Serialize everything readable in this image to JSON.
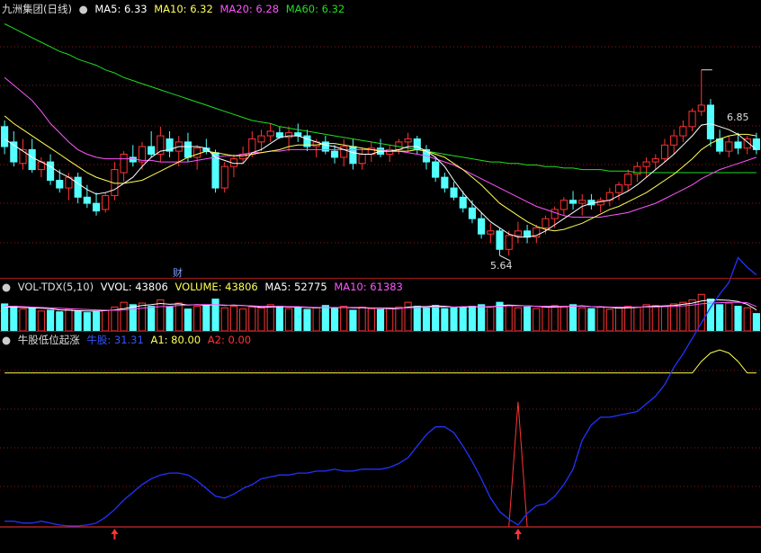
{
  "panel_price": {
    "title": "九洲集团(日线)",
    "indicators": [
      {
        "label": "MA5: 6.33",
        "color": "#ffffff"
      },
      {
        "label": "MA10: 6.32",
        "color": "#ffff55"
      },
      {
        "label": "MA20: 6.28",
        "color": "#ff55ff"
      },
      {
        "label": "MA60: 6.32",
        "color": "#22dd22"
      }
    ],
    "high_label": "6.85",
    "low_label": "5.64",
    "marker_label": "财"
  },
  "panel_volume": {
    "indicators": [
      {
        "label": "VOL-TDX(5,10)",
        "color": "#dddddd"
      },
      {
        "label": "VVOL: 43806",
        "color": "#ffffff"
      },
      {
        "label": "VOLUME: 43806",
        "color": "#ffff55"
      },
      {
        "label": "MA5: 52775",
        "color": "#ffffff"
      },
      {
        "label": "MA10: 61383",
        "color": "#ff55ff"
      }
    ]
  },
  "panel_indicator": {
    "indicators": [
      {
        "label": "牛股低位起涨",
        "color": "#dddddd"
      },
      {
        "label": "牛股: 31.31",
        "color": "#3355ff"
      },
      {
        "label": "A1: 80.00",
        "color": "#ffff55"
      },
      {
        "label": "A2: 0.00",
        "color": "#ff3333"
      }
    ]
  },
  "colors": {
    "up": "#ff3333",
    "down": "#54ffff",
    "ma5": "#ffffff",
    "ma10": "#ffff55",
    "ma20": "#ff55ff",
    "ma60": "#22dd22",
    "niugu": "#2233ff",
    "a1": "#ffff55",
    "a2": "#ff3333",
    "grid": "#8a1a1a",
    "separator": "#a01818"
  },
  "chart_data": [
    {
      "type": "candlestick",
      "title": "九洲集团(日线)",
      "ylim": [
        5.5,
        7.2
      ],
      "ohlc": [
        [
          6.48,
          6.52,
          6.3,
          6.35
        ],
        [
          6.38,
          6.45,
          6.22,
          6.25
        ],
        [
          6.24,
          6.4,
          6.2,
          6.33
        ],
        [
          6.33,
          6.4,
          6.18,
          6.2
        ],
        [
          6.2,
          6.28,
          6.15,
          6.25
        ],
        [
          6.25,
          6.3,
          6.1,
          6.13
        ],
        [
          6.13,
          6.2,
          6.05,
          6.08
        ],
        [
          6.08,
          6.18,
          6.0,
          6.15
        ],
        [
          6.15,
          6.18,
          5.98,
          6.02
        ],
        [
          6.02,
          6.1,
          5.95,
          5.98
        ],
        [
          5.98,
          6.05,
          5.9,
          5.93
        ],
        [
          5.94,
          6.05,
          5.92,
          6.03
        ],
        [
          6.03,
          6.25,
          6.0,
          6.2
        ],
        [
          6.18,
          6.32,
          6.12,
          6.3
        ],
        [
          6.28,
          6.36,
          6.22,
          6.25
        ],
        [
          6.25,
          6.38,
          6.2,
          6.35
        ],
        [
          6.35,
          6.45,
          6.28,
          6.3
        ],
        [
          6.3,
          6.48,
          6.25,
          6.42
        ],
        [
          6.4,
          6.45,
          6.28,
          6.32
        ],
        [
          6.32,
          6.42,
          6.22,
          6.38
        ],
        [
          6.38,
          6.44,
          6.25,
          6.28
        ],
        [
          6.28,
          6.36,
          6.2,
          6.34
        ],
        [
          6.34,
          6.4,
          6.3,
          6.32
        ],
        [
          6.31,
          6.33,
          6.05,
          6.08
        ],
        [
          6.08,
          6.25,
          6.05,
          6.22
        ],
        [
          6.22,
          6.3,
          6.15,
          6.27
        ],
        [
          6.27,
          6.35,
          6.24,
          6.3
        ],
        [
          6.3,
          6.45,
          6.28,
          6.4
        ],
        [
          6.38,
          6.46,
          6.32,
          6.42
        ],
        [
          6.42,
          6.5,
          6.38,
          6.45
        ],
        [
          6.44,
          6.48,
          6.4,
          6.41
        ],
        [
          6.41,
          6.48,
          6.32,
          6.44
        ],
        [
          6.44,
          6.5,
          6.38,
          6.42
        ],
        [
          6.42,
          6.46,
          6.32,
          6.35
        ],
        [
          6.35,
          6.4,
          6.28,
          6.38
        ],
        [
          6.38,
          6.42,
          6.3,
          6.32
        ],
        [
          6.32,
          6.36,
          6.24,
          6.28
        ],
        [
          6.28,
          6.4,
          6.22,
          6.35
        ],
        [
          6.35,
          6.4,
          6.2,
          6.24
        ],
        [
          6.24,
          6.34,
          6.2,
          6.3
        ],
        [
          6.3,
          6.38,
          6.25,
          6.34
        ],
        [
          6.34,
          6.4,
          6.28,
          6.3
        ],
        [
          6.3,
          6.36,
          6.25,
          6.33
        ],
        [
          6.33,
          6.4,
          6.3,
          6.38
        ],
        [
          6.38,
          6.44,
          6.32,
          6.4
        ],
        [
          6.4,
          6.42,
          6.3,
          6.33
        ],
        [
          6.33,
          6.36,
          6.2,
          6.25
        ],
        [
          6.25,
          6.28,
          6.12,
          6.15
        ],
        [
          6.15,
          6.18,
          6.05,
          6.08
        ],
        [
          6.08,
          6.12,
          6.0,
          6.02
        ],
        [
          6.02,
          6.06,
          5.92,
          5.95
        ],
        [
          5.95,
          6.0,
          5.85,
          5.88
        ],
        [
          5.88,
          5.92,
          5.75,
          5.78
        ],
        [
          5.78,
          5.85,
          5.72,
          5.8
        ],
        [
          5.8,
          5.82,
          5.64,
          5.68
        ],
        [
          5.68,
          5.8,
          5.64,
          5.77
        ],
        [
          5.77,
          5.86,
          5.72,
          5.8
        ],
        [
          5.8,
          5.84,
          5.72,
          5.76
        ],
        [
          5.76,
          5.84,
          5.72,
          5.82
        ],
        [
          5.82,
          5.9,
          5.78,
          5.88
        ],
        [
          5.88,
          5.96,
          5.82,
          5.94
        ],
        [
          5.94,
          6.02,
          5.9,
          6.0
        ],
        [
          6.0,
          6.06,
          5.94,
          5.98
        ],
        [
          5.98,
          6.04,
          5.9,
          6.0
        ],
        [
          6.0,
          6.04,
          5.94,
          5.97
        ],
        [
          5.97,
          6.02,
          5.92,
          6.0
        ],
        [
          6.0,
          6.08,
          5.96,
          6.05
        ],
        [
          6.05,
          6.12,
          6.0,
          6.1
        ],
        [
          6.1,
          6.2,
          6.06,
          6.17
        ],
        [
          6.17,
          6.25,
          6.12,
          6.22
        ],
        [
          6.22,
          6.28,
          6.15,
          6.25
        ],
        [
          6.25,
          6.3,
          6.2,
          6.27
        ],
        [
          6.27,
          6.4,
          6.25,
          6.36
        ],
        [
          6.36,
          6.46,
          6.3,
          6.42
        ],
        [
          6.42,
          6.52,
          6.38,
          6.48
        ],
        [
          6.48,
          6.6,
          6.45,
          6.58
        ],
        [
          6.58,
          6.85,
          6.55,
          6.62
        ],
        [
          6.62,
          6.66,
          6.35,
          6.4
        ],
        [
          6.4,
          6.46,
          6.3,
          6.32
        ],
        [
          6.32,
          6.42,
          6.28,
          6.38
        ],
        [
          6.38,
          6.44,
          6.3,
          6.34
        ],
        [
          6.34,
          6.42,
          6.3,
          6.4
        ],
        [
          6.4,
          6.44,
          6.3,
          6.33
        ]
      ],
      "ma5": [
        6.4,
        6.36,
        6.32,
        6.28,
        6.25,
        6.22,
        6.18,
        6.15,
        6.11,
        6.07,
        6.04,
        6.05,
        6.07,
        6.11,
        6.15,
        6.22,
        6.28,
        6.32,
        6.33,
        6.35,
        6.35,
        6.35,
        6.34,
        6.28,
        6.26,
        6.24,
        6.24,
        6.31,
        6.33,
        6.37,
        6.41,
        6.42,
        6.42,
        6.4,
        6.38,
        6.36,
        6.35,
        6.33,
        6.31,
        6.3,
        6.3,
        6.32,
        6.32,
        6.33,
        6.35,
        6.35,
        6.32,
        6.28,
        6.22,
        6.13,
        6.05,
        5.98,
        5.92,
        5.86,
        5.82,
        5.78,
        5.76,
        5.76,
        5.77,
        5.8,
        5.84,
        5.88,
        5.92,
        5.96,
        5.98,
        5.99,
        6.0,
        6.03,
        6.06,
        6.1,
        6.15,
        6.2,
        6.25,
        6.3,
        6.36,
        6.42,
        6.49,
        6.5,
        6.48,
        6.46,
        6.43,
        6.38,
        6.33
      ],
      "ma10": [
        6.55,
        6.5,
        6.46,
        6.42,
        6.38,
        6.34,
        6.3,
        6.26,
        6.22,
        6.18,
        6.15,
        6.13,
        6.11,
        6.11,
        6.12,
        6.13,
        6.16,
        6.19,
        6.22,
        6.25,
        6.28,
        6.3,
        6.32,
        6.31,
        6.3,
        6.29,
        6.29,
        6.3,
        6.31,
        6.32,
        6.33,
        6.35,
        6.36,
        6.36,
        6.36,
        6.37,
        6.37,
        6.36,
        6.35,
        6.34,
        6.33,
        6.32,
        6.32,
        6.32,
        6.32,
        6.33,
        6.32,
        6.3,
        6.28,
        6.24,
        6.2,
        6.15,
        6.1,
        6.04,
        5.98,
        5.94,
        5.9,
        5.86,
        5.83,
        5.81,
        5.8,
        5.81,
        5.83,
        5.85,
        5.88,
        5.91,
        5.94,
        5.96,
        5.99,
        6.02,
        6.05,
        6.09,
        6.13,
        6.17,
        6.22,
        6.27,
        6.33,
        6.37,
        6.4,
        6.42,
        6.43,
        6.43,
        6.42
      ],
      "ma20": [
        6.8,
        6.75,
        6.7,
        6.65,
        6.58,
        6.5,
        6.44,
        6.38,
        6.33,
        6.3,
        6.28,
        6.27,
        6.27,
        6.27,
        6.27,
        6.26,
        6.26,
        6.25,
        6.25,
        6.25,
        6.25,
        6.26,
        6.27,
        6.28,
        6.29,
        6.29,
        6.3,
        6.31,
        6.31,
        6.32,
        6.32,
        6.33,
        6.33,
        6.33,
        6.33,
        6.33,
        6.33,
        6.33,
        6.33,
        6.33,
        6.33,
        6.33,
        6.32,
        6.32,
        6.31,
        6.3,
        6.29,
        6.27,
        6.25,
        6.23,
        6.2,
        6.17,
        6.14,
        6.11,
        6.08,
        6.05,
        6.02,
        5.99,
        5.96,
        5.94,
        5.92,
        5.9,
        5.89,
        5.89,
        5.89,
        5.89,
        5.9,
        5.91,
        5.92,
        5.94,
        5.96,
        5.98,
        6.01,
        6.04,
        6.07,
        6.1,
        6.14,
        6.17,
        6.2,
        6.22,
        6.24,
        6.26,
        6.28
      ],
      "ma60": [
        7.15,
        7.12,
        7.09,
        7.06,
        7.03,
        7.0,
        6.97,
        6.95,
        6.92,
        6.9,
        6.88,
        6.85,
        6.83,
        6.8,
        6.78,
        6.76,
        6.74,
        6.72,
        6.7,
        6.68,
        6.66,
        6.64,
        6.62,
        6.6,
        6.58,
        6.56,
        6.54,
        6.52,
        6.51,
        6.5,
        6.48,
        6.47,
        6.46,
        6.45,
        6.44,
        6.43,
        6.42,
        6.41,
        6.4,
        6.39,
        6.38,
        6.37,
        6.36,
        6.35,
        6.34,
        6.33,
        6.32,
        6.31,
        6.3,
        6.29,
        6.28,
        6.27,
        6.26,
        6.25,
        6.25,
        6.24,
        6.24,
        6.23,
        6.23,
        6.22,
        6.22,
        6.21,
        6.21,
        6.2,
        6.2,
        6.2,
        6.19,
        6.19,
        6.19,
        6.18,
        6.18,
        6.18,
        6.18,
        6.18,
        6.18,
        6.18,
        6.18,
        6.18,
        6.18,
        6.18,
        6.18,
        6.18,
        6.18
      ]
    },
    {
      "type": "bar",
      "title": "VOL-TDX(5,10)",
      "ylim": [
        0,
        95000
      ],
      "values": [
        68000,
        62000,
        55000,
        58000,
        50000,
        52000,
        48000,
        55000,
        50000,
        46000,
        48000,
        52000,
        60000,
        72000,
        66000,
        70000,
        62000,
        78000,
        60000,
        70000,
        55000,
        62000,
        65000,
        80000,
        58000,
        62000,
        55000,
        60000,
        58000,
        66000,
        62000,
        56000,
        60000,
        54000,
        58000,
        64000,
        56000,
        62000,
        52000,
        60000,
        56000,
        54000,
        58000,
        60000,
        72000,
        62000,
        58000,
        64000,
        56000,
        60000,
        58000,
        62000,
        66000,
        60000,
        72000,
        64000,
        58000,
        60000,
        56000,
        62000,
        64000,
        60000,
        66000,
        58000,
        56000,
        60000,
        54000,
        58000,
        62000,
        60000,
        66000,
        64000,
        62000,
        68000,
        72000,
        78000,
        92000,
        80000,
        66000,
        70000,
        62000,
        58000,
        43806
      ],
      "ma5": [
        60000,
        60000,
        59000,
        58000,
        57000,
        56000,
        53000,
        52000,
        51000,
        50000,
        50000,
        51000,
        53000,
        56000,
        60000,
        64000,
        66000,
        69000,
        67000,
        68000,
        65000,
        66000,
        64000,
        66000,
        64000,
        65000,
        64000,
        62000,
        59000,
        60000,
        61000,
        60000,
        60000,
        59000,
        58000,
        59000,
        58000,
        59000,
        58000,
        58000,
        57000,
        57000,
        56000,
        56000,
        60000,
        61000,
        61000,
        63000,
        62000,
        60000,
        60000,
        60000,
        61000,
        60000,
        64000,
        65000,
        64000,
        63000,
        62000,
        60000,
        60000,
        61000,
        62000,
        63000,
        61000,
        60000,
        59000,
        57000,
        58000,
        59000,
        61000,
        62000,
        63000,
        64000,
        67000,
        70000,
        75000,
        78000,
        78000,
        77000,
        74000,
        67000,
        52775
      ],
      "ma10": [
        62000,
        62000,
        61000,
        60000,
        59000,
        58000,
        57000,
        56000,
        55000,
        54000,
        53000,
        52000,
        52000,
        53000,
        55000,
        57000,
        59000,
        61000,
        62000,
        64000,
        65000,
        66000,
        66000,
        66000,
        65000,
        64000,
        64000,
        63000,
        62000,
        62000,
        62000,
        61000,
        61000,
        60000,
        59000,
        59000,
        59000,
        59000,
        59000,
        59000,
        58000,
        58000,
        58000,
        57000,
        58000,
        59000,
        59000,
        60000,
        60000,
        60000,
        61000,
        61000,
        61000,
        61000,
        62000,
        63000,
        63000,
        63000,
        62000,
        62000,
        62000,
        62000,
        62000,
        62000,
        61000,
        61000,
        60000,
        60000,
        60000,
        60000,
        60000,
        60000,
        61000,
        62000,
        63000,
        65000,
        68000,
        70000,
        71000,
        72000,
        72000,
        71000,
        61383
      ]
    },
    {
      "type": "line",
      "title": "牛股低位起涨",
      "ylim": [
        0,
        100
      ],
      "series": [
        {
          "name": "牛股",
          "values": [
            3,
            3,
            2,
            2,
            3,
            2,
            1,
            0.5,
            0.5,
            1,
            2,
            5,
            9,
            14,
            18,
            22,
            25,
            27,
            28,
            28,
            27,
            24,
            20,
            16,
            15,
            17,
            20,
            22,
            25,
            26,
            27,
            27,
            28,
            28,
            29,
            29,
            30,
            29,
            29,
            30,
            30,
            30,
            31,
            33,
            36,
            42,
            48,
            52,
            52,
            49,
            42,
            34,
            25,
            15,
            8,
            4,
            1,
            7,
            11,
            12,
            16,
            22,
            30,
            45,
            53,
            57,
            57,
            58,
            59,
            60,
            64,
            68,
            74,
            83,
            90,
            98,
            106,
            114,
            121,
            127,
            140,
            135,
            131
          ]
        },
        {
          "name": "A1",
          "values": [
            80
          ]
        },
        {
          "name": "A2",
          "values": [
            0
          ]
        }
      ]
    }
  ]
}
